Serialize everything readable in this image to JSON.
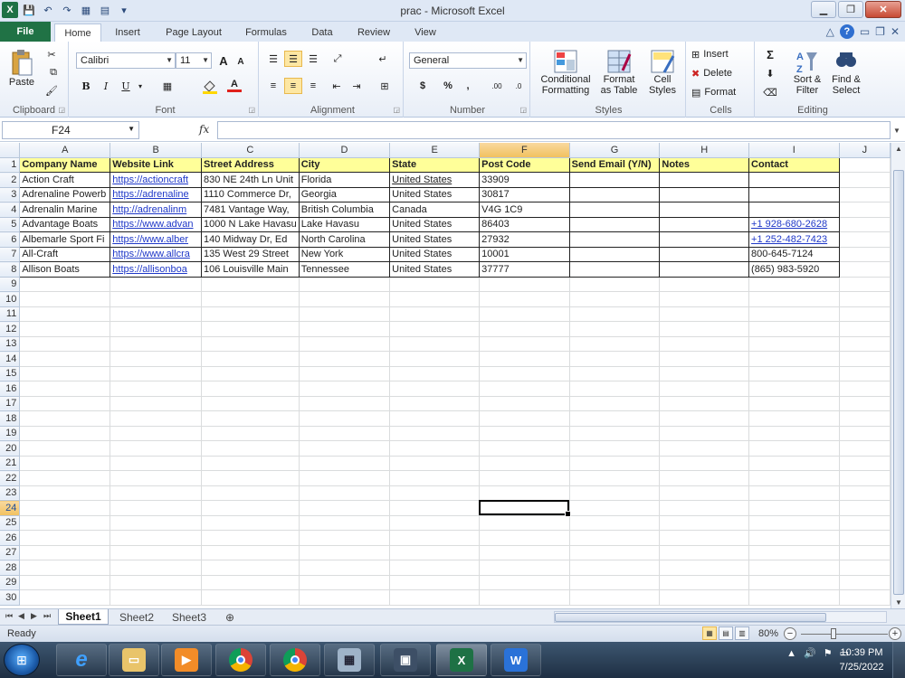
{
  "window": {
    "title": "prac - Microsoft Excel"
  },
  "ribbon_tabs": [
    "File",
    "Home",
    "Insert",
    "Page Layout",
    "Formulas",
    "Data",
    "Review",
    "View"
  ],
  "ribbon": {
    "clipboard": {
      "paste": "Paste",
      "label": "Clipboard"
    },
    "font": {
      "name": "Calibri",
      "size": "11",
      "bold": "B",
      "italic": "I",
      "underline": "U",
      "grow": "A",
      "shrink": "A",
      "font_color": "A",
      "label": "Font"
    },
    "alignment": {
      "label": "Alignment"
    },
    "number": {
      "format": "General",
      "currency": "$",
      "percent": "%",
      "comma": ",",
      "inc_dec": ".00",
      "dec_dec": ".0",
      "label": "Number"
    },
    "styles": {
      "conditional": "Conditional",
      "conditional2": "Formatting",
      "format_as_table": "Format",
      "format_as_table2": "as Table",
      "cell_styles": "Cell",
      "cell_styles2": "Styles",
      "label": "Styles"
    },
    "cells": {
      "insert": "Insert",
      "delete": "Delete",
      "format": "Format",
      "label": "Cells"
    },
    "editing": {
      "sigma": "Σ",
      "sort": "Sort &",
      "sort2": "Filter",
      "find": "Find &",
      "find2": "Select",
      "label": "Editing"
    }
  },
  "formula_bar": {
    "name_box": "F24",
    "fx": "fx",
    "formula": ""
  },
  "columns": [
    "A",
    "B",
    "C",
    "D",
    "E",
    "F",
    "G",
    "H",
    "I",
    "J"
  ],
  "selected_column": "F",
  "selected_row": 24,
  "rows_total": 30,
  "table": {
    "headers": [
      "Company Name",
      "Website Link",
      "Street Address",
      "City",
      "State",
      "Post Code",
      "Send Email (Y/N)",
      "Notes",
      "Contact"
    ],
    "rows": [
      [
        "Action Craft",
        "https://actioncraft",
        "830 NE 24th Ln Unit",
        "Florida",
        "United States",
        "33909",
        "",
        "",
        ""
      ],
      [
        "Adrenaline Powerb",
        "https://adrenaline",
        "1110 Commerce Dr,",
        "Georgia",
        "United States",
        "30817",
        "",
        "",
        ""
      ],
      [
        "Adrenalin Marine",
        "http://adrenalinm",
        "7481 Vantage Way,",
        "British Columbia",
        "Canada",
        "V4G 1C9",
        "",
        "",
        ""
      ],
      [
        "Advantage Boats",
        "https://www.advan",
        "1000 N Lake Havasu",
        "Lake Havasu",
        "United States",
        "86403",
        "",
        "",
        "+1 928-680-2628"
      ],
      [
        "Albemarle Sport Fi",
        "https://www.alber",
        "140 Midway Dr, Ed",
        "North Carolina",
        "United States",
        "27932",
        "",
        "",
        "+1 252-482-7423"
      ],
      [
        "All-Craft",
        "https://www.allcra",
        "135 West 29 Street",
        "New York",
        "United States",
        "10001",
        "",
        "",
        "800-645-7124"
      ],
      [
        "Allison Boats",
        "https://allisonboa",
        "106 Louisville Main",
        "Tennessee",
        "United States",
        "37777",
        "",
        "",
        "(865) 983-5920"
      ]
    ]
  },
  "sheets": [
    "Sheet1",
    "Sheet2",
    "Sheet3"
  ],
  "active_sheet": "Sheet1",
  "status": {
    "text": "Ready",
    "zoom": "80%"
  },
  "taskbar": {
    "time": "10:39 PM",
    "date": "7/25/2022"
  }
}
